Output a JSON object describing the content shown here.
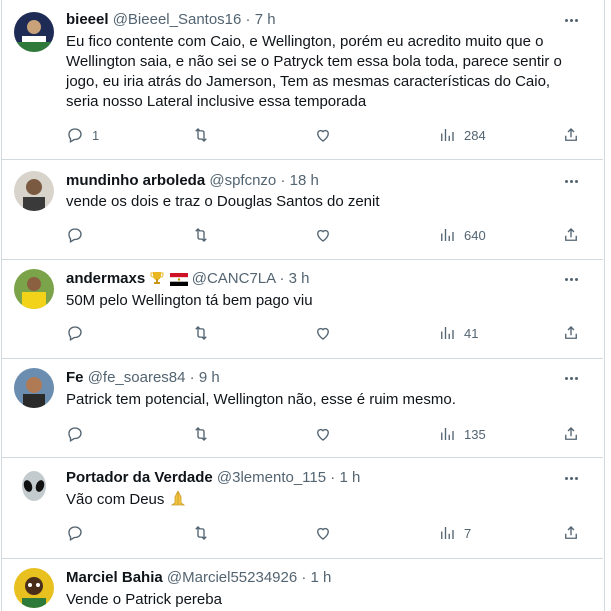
{
  "tweets": [
    {
      "name": "bieeel",
      "handle": "@Bieeel_Santos16",
      "time": "7 h",
      "text": "Eu fico contente com Caio, e Wellington, porém eu acredito muito que o Wellington saia, e não sei se o Patryck tem essa bola toda, parece sentir o jogo, eu iria atrás do Jamerson, Tem as mesmas características do Caio, seria nosso Lateral inclusive essa temporada",
      "replies": "1",
      "retweets": "",
      "likes": "",
      "views": "284",
      "avatar_color": "#2a3a6a"
    },
    {
      "name": "mundinho arboleda",
      "handle": "@spfcnzo",
      "time": "18 h",
      "text": "vende os dois e traz o Douglas Santos do zenit",
      "replies": "",
      "retweets": "",
      "likes": "",
      "views": "640",
      "avatar_color": "#7a6a5a"
    },
    {
      "name": "andermaxs",
      "handle": "@CANC7LA",
      "time": "3 h",
      "text": "50M pelo Wellington tá bem pago viu",
      "replies": "",
      "retweets": "",
      "likes": "",
      "views": "41",
      "avatar_color": "#d9c23a"
    },
    {
      "name": "Fe",
      "handle": "@fe_soares84",
      "time": "9 h",
      "text": "Patrick tem potencial, Wellington não, esse é ruim mesmo.",
      "replies": "",
      "retweets": "",
      "likes": "",
      "views": "135",
      "avatar_color": "#5a7a9a"
    },
    {
      "name": "Portador da Verdade",
      "handle": "@3lemento_115",
      "time": "1 h",
      "text": "Vão com Deus",
      "replies": "",
      "retweets": "",
      "likes": "",
      "views": "7",
      "avatar_color": "#b8c0c4"
    },
    {
      "name": "Marciel Bahia",
      "handle": "@Marciel55234926",
      "time": "1 h",
      "text": "Vende o Patrick pereba",
      "avatar_color": "#c8a020"
    }
  ],
  "separator": "·",
  "icons": [
    "reply-icon",
    "retweet-icon",
    "like-icon",
    "views-icon",
    "share-icon",
    "more-icon"
  ],
  "colors": {
    "text": "#0f1419",
    "secondary": "#536471",
    "border": "#cfd9de"
  }
}
